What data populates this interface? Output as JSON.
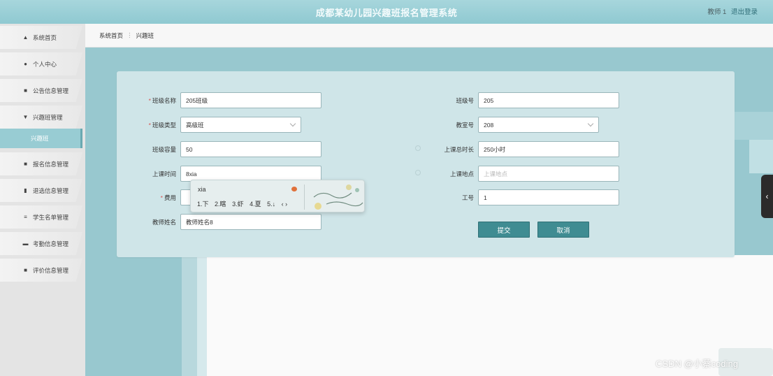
{
  "header": {
    "title": "成都某幼儿园兴趣班报名管理系统",
    "user": "教师 1",
    "logout": "退出登录"
  },
  "sidebar": {
    "items": [
      {
        "label": "系统首页",
        "icon": "home-icon"
      },
      {
        "label": "个人中心",
        "icon": "user-icon"
      },
      {
        "label": "公告信息管理",
        "icon": "grid-icon"
      },
      {
        "label": "兴趣班管理",
        "icon": "cup-icon"
      },
      {
        "label": "兴趣班",
        "icon": ""
      },
      {
        "label": "报名信息管理",
        "icon": "grid-icon"
      },
      {
        "label": "退选信息管理",
        "icon": "trash-icon"
      },
      {
        "label": "学生名单管理",
        "icon": "list-icon"
      },
      {
        "label": "考勤信息管理",
        "icon": "monitor-icon"
      },
      {
        "label": "评价信息管理",
        "icon": "grid-icon"
      }
    ]
  },
  "breadcrumb": {
    "home": "系统首页",
    "separator": "⋮",
    "current": "兴趣班"
  },
  "form": {
    "class_name": {
      "label": "班级名称",
      "value": "205班级",
      "required": true
    },
    "class_no": {
      "label": "班级号",
      "value": "205"
    },
    "class_type": {
      "label": "班级类型",
      "value": "高级班",
      "required": true
    },
    "room_no": {
      "label": "教室号",
      "value": "208"
    },
    "capacity": {
      "label": "班级容量",
      "value": "50"
    },
    "total_hours": {
      "label": "上课总时长",
      "value": "250小时"
    },
    "class_time": {
      "label": "上课时间",
      "value": "8xia"
    },
    "location": {
      "label": "上课地点",
      "placeholder": "上课地点"
    },
    "fee": {
      "label": "费用",
      "required": true
    },
    "staff_no": {
      "label": "工号",
      "value": "1"
    },
    "teacher_name": {
      "label": "教师姓名",
      "value": "教师姓名8"
    },
    "submit": "提交",
    "cancel": "取消"
  },
  "ime": {
    "composition": "xia",
    "candidates": [
      "1.下",
      "2.瞎",
      "3.虾",
      "4.夏",
      "5.↓"
    ],
    "nav": "‹ ›"
  },
  "watermark": "CSDN @小蔡coding"
}
